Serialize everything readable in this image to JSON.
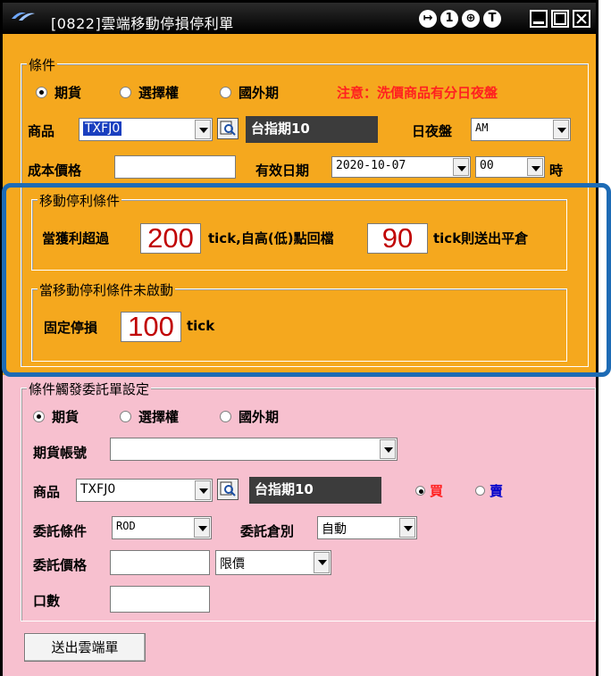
{
  "window": {
    "title": "[0822]雲端移動停損停利單",
    "title_buttons": [
      "↦",
      "1",
      "⊕",
      "T"
    ]
  },
  "condition": {
    "group_title": "條件",
    "radios": [
      {
        "label": "期貨",
        "checked": true
      },
      {
        "label": "選擇權",
        "checked": false
      },
      {
        "label": "國外期",
        "checked": false
      }
    ],
    "notice": "注意：洗價商品有分日夜盤",
    "product_label": "商品",
    "product_value": "TXFJ0",
    "product_name": "台指期10",
    "session_label": "日夜盤",
    "session_value": "AM",
    "cost_label": "成本價格",
    "cost_value": "",
    "expiry_label": "有效日期",
    "expiry_date": "2020-10-07",
    "expiry_hour": "00",
    "hour_suffix": "時"
  },
  "trailing": {
    "group_title": "移動停利條件",
    "profit_prefix": "當獲利超過",
    "profit_ticks": "200",
    "profit_mid": "tick,自高(低)點回檔",
    "pullback_ticks": "90",
    "pullback_suffix": "tick則送出平倉"
  },
  "fixed_stop": {
    "group_title": "當移動停利條件未啟動",
    "label": "固定停損",
    "ticks": "100",
    "suffix": "tick"
  },
  "order": {
    "group_title": "條件觸發委託單設定",
    "radios": [
      {
        "label": "期貨",
        "checked": true
      },
      {
        "label": "選擇權",
        "checked": false
      },
      {
        "label": "國外期",
        "checked": false
      }
    ],
    "account_label": "期貨帳號",
    "account_value": "",
    "product_label": "商品",
    "product_value": "TXFJ0",
    "product_name": "台指期10",
    "side_buy": "買",
    "side_sell": "賣",
    "side_selected": "買",
    "cond_label": "委託條件",
    "cond_value": "ROD",
    "position_label": "委託倉別",
    "position_value": "自動",
    "price_label": "委託價格",
    "price_value": "",
    "price_type": "限價",
    "qty_label": "口數",
    "qty_value": ""
  },
  "submit_label": "送出雲端單",
  "colors": {
    "top_panel": "#f5a81e",
    "bottom_panel": "#f7c0cf",
    "highlight_border": "#1d6bb5",
    "notice_red": "#ff2020",
    "value_red": "#c00000",
    "sell_blue": "#0000cc"
  }
}
